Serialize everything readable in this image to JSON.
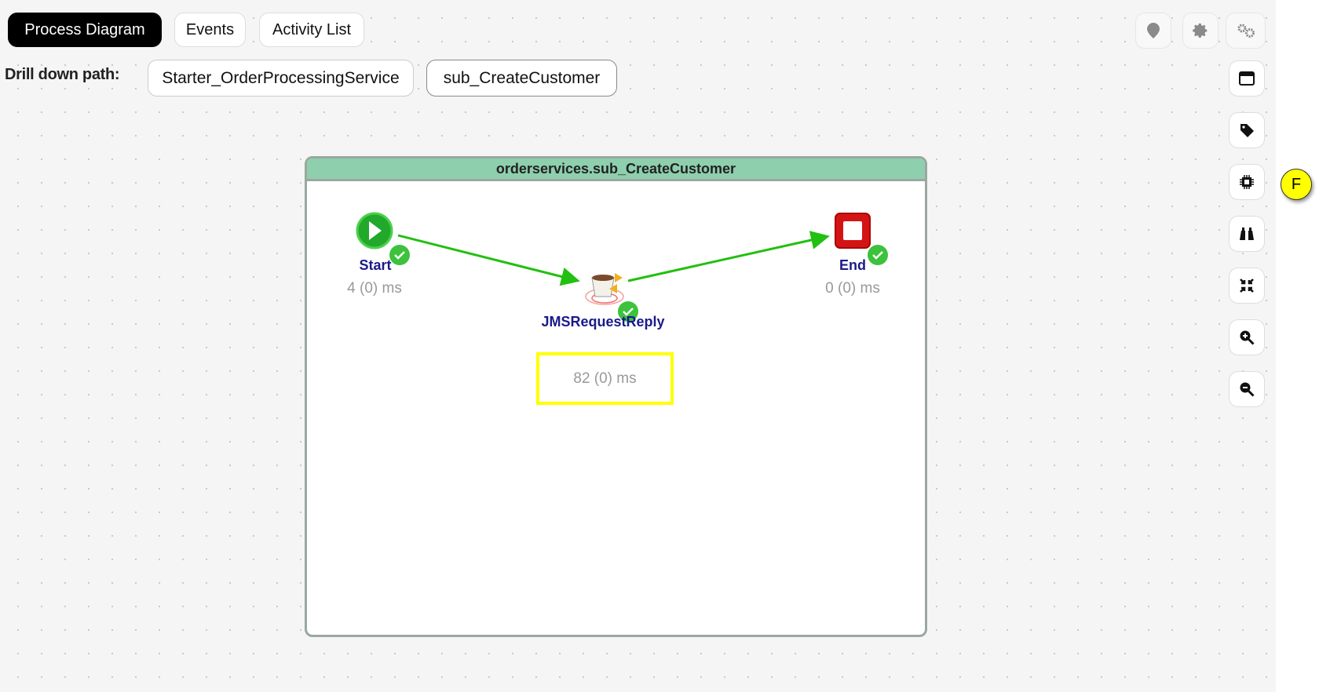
{
  "tabs": [
    {
      "label": "Process Diagram",
      "active": true
    },
    {
      "label": "Events",
      "active": false
    },
    {
      "label": "Activity List",
      "active": false
    }
  ],
  "drill_down": {
    "label": "Drill down path:",
    "items": [
      "Starter_OrderProcessingService",
      "sub_CreateCustomer"
    ]
  },
  "top_toolbar": [
    "location-pin-icon",
    "gear-icon",
    "gears-icon"
  ],
  "side_toolbar": [
    "window-icon",
    "tag-icon",
    "chip-icon",
    "binoculars-icon",
    "compress-icon",
    "zoom-in-icon",
    "zoom-out-icon"
  ],
  "badge": {
    "label": "F",
    "color": "#ffff00"
  },
  "process": {
    "title": "orderservices.sub_CreateCustomer",
    "header_color": "#8ecfae",
    "nodes": [
      {
        "name": "Start",
        "time": "4 (0) ms",
        "status": "success"
      },
      {
        "name": "JMSRequestReply",
        "time": "82 (0) ms",
        "status": "success",
        "highlighted": true
      },
      {
        "name": "End",
        "time": "0 (0) ms",
        "status": "success"
      }
    ],
    "transition_color": "#22c010"
  }
}
